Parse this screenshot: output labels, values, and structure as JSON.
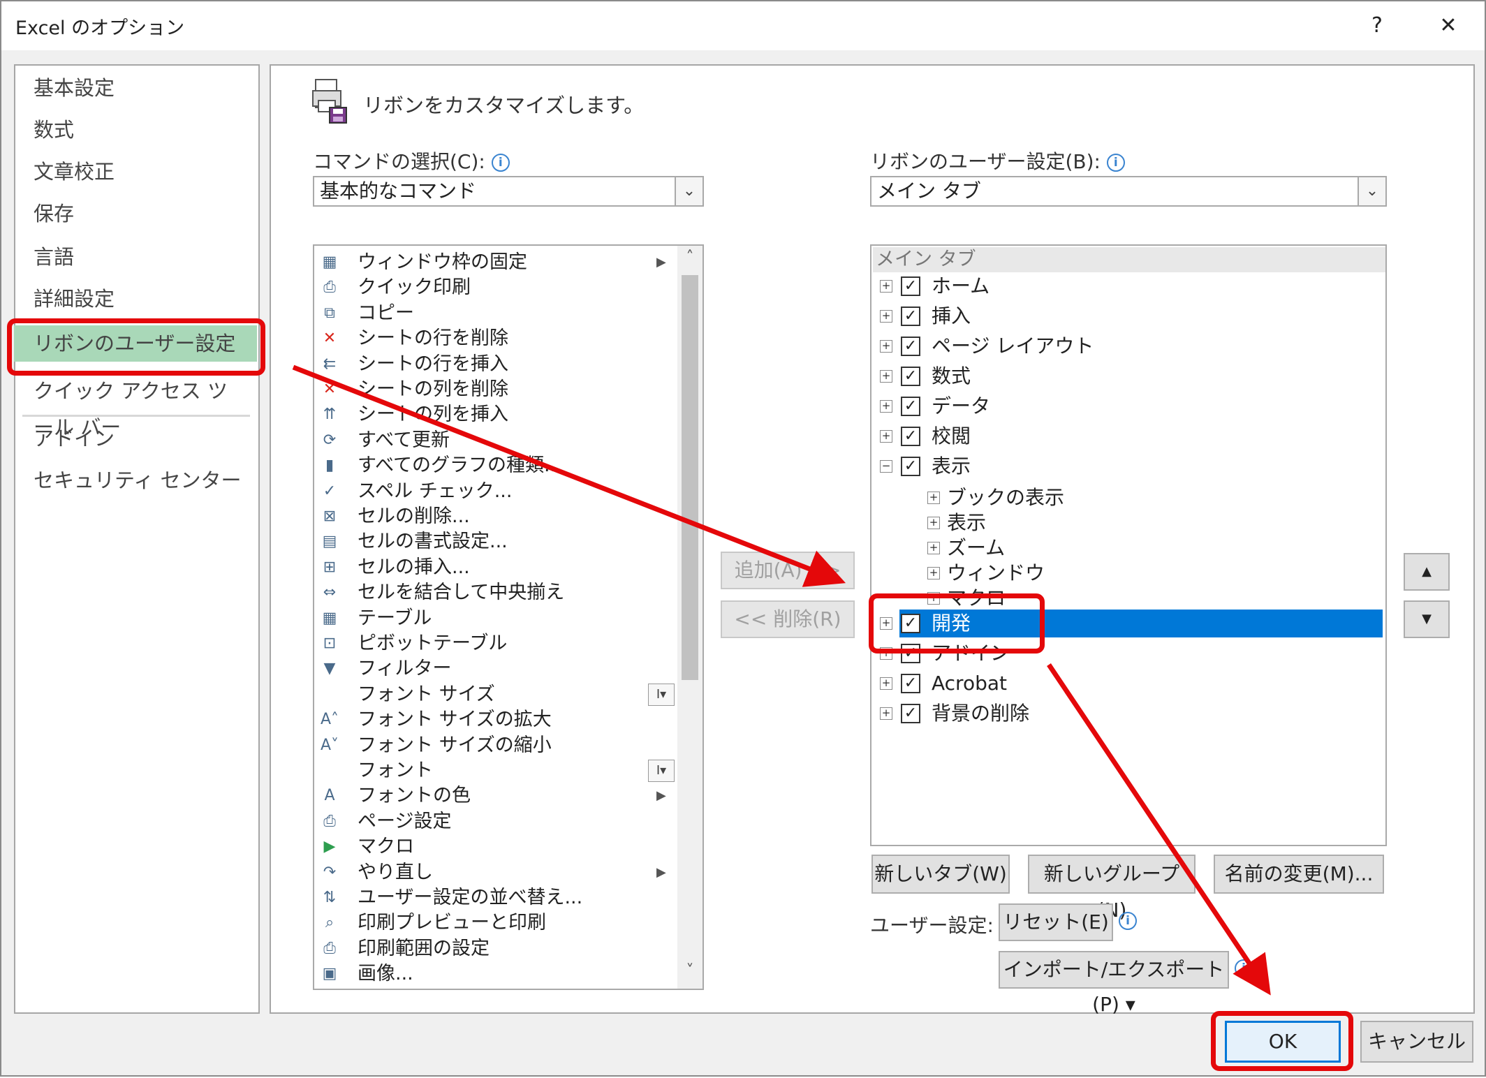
{
  "window": {
    "title": "Excel のオプション",
    "help": "?",
    "close": "✕"
  },
  "sidebar": {
    "items": [
      {
        "label": "基本設定"
      },
      {
        "label": "数式"
      },
      {
        "label": "文章校正"
      },
      {
        "label": "保存"
      },
      {
        "label": "言語"
      },
      {
        "label": "詳細設定"
      },
      {
        "label": "リボンのユーザー設定",
        "selected": true
      },
      {
        "label": "クイック アクセス ツール バー"
      },
      {
        "label": "アドイン"
      },
      {
        "label": "セキュリティ センター"
      }
    ]
  },
  "header": {
    "text": "リボンをカスタマイズします。"
  },
  "commands": {
    "label": "コマンドの選択(C):",
    "selected": "基本的なコマンド",
    "items": [
      {
        "label": "ウィンドウ枠の固定",
        "icon": "freeze-panes-icon",
        "glyph": "▦",
        "submenu": true
      },
      {
        "label": "クイック印刷",
        "icon": "quick-print-icon",
        "glyph": "⎙"
      },
      {
        "label": "コピー",
        "icon": "copy-icon",
        "glyph": "⧉"
      },
      {
        "label": "シートの行を削除",
        "icon": "delete-row-icon",
        "glyph": "✕"
      },
      {
        "label": "シートの行を挿入",
        "icon": "insert-row-icon",
        "glyph": "⇇"
      },
      {
        "label": "シートの列を削除",
        "icon": "delete-column-icon",
        "glyph": "✕"
      },
      {
        "label": "シートの列を挿入",
        "icon": "insert-column-icon",
        "glyph": "⇈"
      },
      {
        "label": "すべて更新",
        "icon": "refresh-all-icon",
        "glyph": "⟳"
      },
      {
        "label": "すべてのグラフの種類...",
        "icon": "chart-types-icon",
        "glyph": "▮"
      },
      {
        "label": "スペル チェック...",
        "icon": "spell-check-icon",
        "glyph": "✓"
      },
      {
        "label": "セルの削除...",
        "icon": "delete-cells-icon",
        "glyph": "⊠"
      },
      {
        "label": "セルの書式設定...",
        "icon": "format-cells-icon",
        "glyph": "▤"
      },
      {
        "label": "セルの挿入...",
        "icon": "insert-cells-icon",
        "glyph": "⊞"
      },
      {
        "label": "セルを結合して中央揃え",
        "icon": "merge-center-icon",
        "glyph": "⇔"
      },
      {
        "label": "テーブル",
        "icon": "table-icon",
        "glyph": "▦"
      },
      {
        "label": "ピボットテーブル",
        "icon": "pivot-table-icon",
        "glyph": "⊡"
      },
      {
        "label": "フィルター",
        "icon": "filter-icon",
        "glyph": "▼"
      },
      {
        "label": "フォント サイズ",
        "icon": "font-size-icon",
        "glyph": "",
        "picker": "I▾"
      },
      {
        "label": "フォント サイズの拡大",
        "icon": "font-grow-icon",
        "glyph": "A˄"
      },
      {
        "label": "フォント サイズの縮小",
        "icon": "font-shrink-icon",
        "glyph": "A˅"
      },
      {
        "label": "フォント",
        "icon": "font-icon",
        "glyph": "",
        "picker": "I▾"
      },
      {
        "label": "フォントの色",
        "icon": "font-color-icon",
        "glyph": "A",
        "submenu": true
      },
      {
        "label": "ページ設定",
        "icon": "page-setup-icon",
        "glyph": "⎙"
      },
      {
        "label": "マクロ",
        "icon": "macro-icon",
        "glyph": "▶"
      },
      {
        "label": "やり直し",
        "icon": "redo-icon",
        "glyph": "↷",
        "submenu": true
      },
      {
        "label": "ユーザー設定の並べ替え...",
        "icon": "custom-sort-icon",
        "glyph": "⇅"
      },
      {
        "label": "印刷プレビューと印刷",
        "icon": "print-preview-icon",
        "glyph": "⌕"
      },
      {
        "label": "印刷範囲の設定",
        "icon": "print-area-icon",
        "glyph": "⎙"
      },
      {
        "label": "画像...",
        "icon": "picture-icon",
        "glyph": "▣"
      }
    ]
  },
  "middle": {
    "add": "追加(A) >>",
    "remove": "<< 削除(R)"
  },
  "ribbon": {
    "label": "リボンのユーザー設定(B):",
    "selected": "メイン タブ",
    "tree_header": "メイン タブ",
    "tabs": [
      {
        "label": "ホーム",
        "expander": "+",
        "level": 0
      },
      {
        "label": "挿入",
        "expander": "+",
        "level": 0
      },
      {
        "label": "ページ レイアウト",
        "expander": "+",
        "level": 0
      },
      {
        "label": "数式",
        "expander": "+",
        "level": 0
      },
      {
        "label": "データ",
        "expander": "+",
        "level": 0
      },
      {
        "label": "校閲",
        "expander": "+",
        "level": 0
      },
      {
        "label": "表示",
        "expander": "−",
        "level": 0
      },
      {
        "label": "ブックの表示",
        "expander": "+",
        "level": 1
      },
      {
        "label": "表示",
        "expander": "+",
        "level": 1
      },
      {
        "label": "ズーム",
        "expander": "+",
        "level": 1
      },
      {
        "label": "ウィンドウ",
        "expander": "+",
        "level": 1
      },
      {
        "label": "マクロ",
        "expander": "+",
        "level": 1
      },
      {
        "label": "開発",
        "expander": "+",
        "level": 0,
        "selected": true
      },
      {
        "label": "アドイン",
        "expander": "+",
        "level": 0
      },
      {
        "label": "Acrobat",
        "expander": "+",
        "level": 0
      },
      {
        "label": "背景の削除",
        "expander": "+",
        "level": 0
      }
    ],
    "new_tab": "新しいタブ(W)",
    "new_group": "新しいグループ(N)",
    "rename": "名前の変更(M)...",
    "user_settings_label": "ユーザー設定:",
    "reset": "リセット(E) ▾",
    "import_export": "インポート/エクスポート(P) ▾",
    "move_up": "▲",
    "move_down": "▼"
  },
  "footer": {
    "ok": "OK",
    "cancel": "キャンセル"
  },
  "colors": {
    "highlight": "#0078d7",
    "selected_nav": "#a9d8b8",
    "annotation": "#e4080a"
  }
}
